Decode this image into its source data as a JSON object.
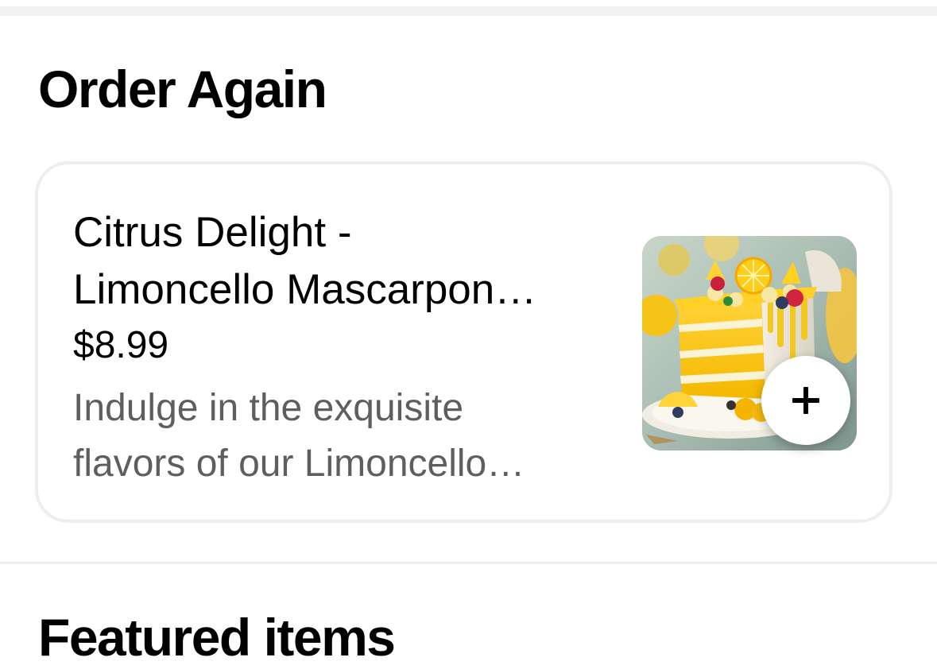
{
  "order_again": {
    "title": "Order Again",
    "item": {
      "name_line1": "Citrus Delight -",
      "name_line2": "Limoncello Mascarpon…",
      "price": "$8.99",
      "description_line1": "Indulge in the exquisite",
      "description_line2": "flavors of our Limoncello…",
      "image_icon": "lemon-cake-image",
      "add_icon": "plus-icon"
    }
  },
  "featured": {
    "title": "Featured items"
  },
  "colors": {
    "background": "#ffffff",
    "divider": "#f1f1f1",
    "card_border": "#eeeeee",
    "text_primary": "#000000",
    "text_secondary": "#5e5e5e"
  }
}
